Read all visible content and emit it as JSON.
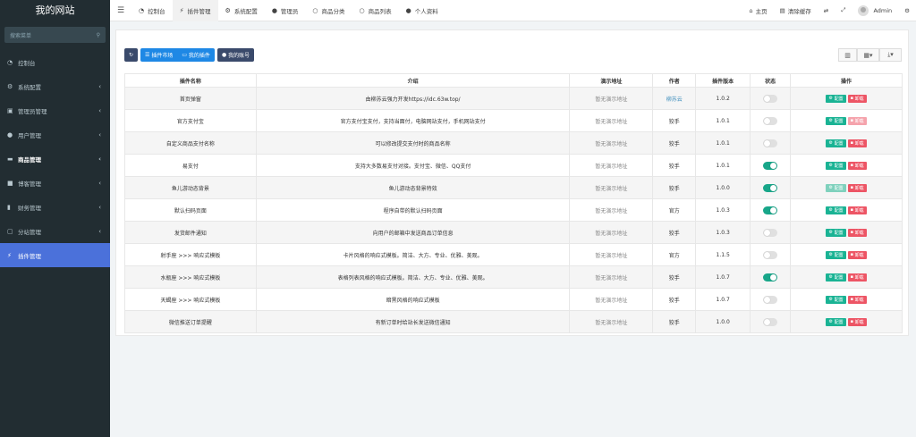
{
  "brand": "我的网站",
  "search": {
    "placeholder": "搜索菜单"
  },
  "menu": [
    {
      "label": "控制台",
      "icon": "dashboard-icon",
      "glyph": "◔",
      "chevron": false,
      "bold": false,
      "active": false
    },
    {
      "label": "系统配置",
      "icon": "gears-icon",
      "glyph": "⚙",
      "chevron": true,
      "bold": false,
      "active": false
    },
    {
      "label": "管理员管理",
      "icon": "users-icon",
      "glyph": "▣",
      "chevron": true,
      "bold": false,
      "active": false
    },
    {
      "label": "用户管理",
      "icon": "user-icon",
      "glyph": "●",
      "chevron": true,
      "bold": false,
      "active": false
    },
    {
      "label": "商品管理",
      "icon": "cart-icon",
      "glyph": "▬",
      "chevron": true,
      "bold": true,
      "active": false
    },
    {
      "label": "博客管理",
      "icon": "book-icon",
      "glyph": "■",
      "chevron": true,
      "bold": false,
      "active": false
    },
    {
      "label": "财务管理",
      "icon": "bookmark-icon",
      "glyph": "▮",
      "chevron": true,
      "bold": false,
      "active": false
    },
    {
      "label": "分站管理",
      "icon": "clone-icon",
      "glyph": "▢",
      "chevron": true,
      "bold": false,
      "active": false
    },
    {
      "label": "插件管理",
      "icon": "plug-icon",
      "glyph": "⚡",
      "chevron": false,
      "bold": false,
      "active": true
    }
  ],
  "tabs": [
    {
      "label": "控制台",
      "icon": "dashboard-icon",
      "glyph": "◔",
      "active": false
    },
    {
      "label": "插件管理",
      "icon": "plug-icon",
      "glyph": "⚡",
      "active": true
    },
    {
      "label": "系统配置",
      "icon": "gear-icon",
      "glyph": "⚙",
      "active": false
    },
    {
      "label": "管理员",
      "icon": "user-icon",
      "glyph": "●",
      "active": false
    },
    {
      "label": "商品分类",
      "icon": "circle-icon",
      "glyph": "○",
      "active": false
    },
    {
      "label": "商品列表",
      "icon": "circle-icon",
      "glyph": "○",
      "active": false
    },
    {
      "label": "个人资料",
      "icon": "user-icon",
      "glyph": "●",
      "active": false
    }
  ],
  "topright": {
    "home": "主页",
    "clear_cache": "清除缓存",
    "user": "Admin"
  },
  "toolbar": {
    "market": "插件市场",
    "mine": "我的插件",
    "account": "我的账号"
  },
  "table": {
    "headers": [
      "插件名称",
      "介绍",
      "演示地址",
      "作者",
      "插件版本",
      "状态",
      "操作"
    ],
    "config_label": "配置",
    "uninstall_label": "卸载",
    "rows": [
      {
        "name": "首页弹窗",
        "desc": "由柳苏云强力开发https://idc.63w.top/",
        "demo": "暂无演示地址",
        "author": "柳苏云",
        "author_link": true,
        "version": "1.0.2",
        "on": false,
        "config_light": false,
        "uninstall_light": false
      },
      {
        "name": "官方支付宝",
        "desc": "官方支付宝支付，支持当面付，电脑网站支付，手机网站支付",
        "demo": "暂无演示地址",
        "author": "狡手",
        "author_link": false,
        "version": "1.0.1",
        "on": false,
        "config_light": false,
        "uninstall_light": true
      },
      {
        "name": "自定义商品支付名称",
        "desc": "可以修改提交支付时的商品名称",
        "demo": "暂无演示地址",
        "author": "狡手",
        "author_link": false,
        "version": "1.0.1",
        "on": false,
        "config_light": false,
        "uninstall_light": false
      },
      {
        "name": "易支付",
        "desc": "支持大多数易支付对接。支付宝、微信、QQ支付",
        "demo": "暂无演示地址",
        "author": "狡手",
        "author_link": false,
        "version": "1.0.1",
        "on": true,
        "config_light": false,
        "uninstall_light": false
      },
      {
        "name": "鱼儿游动态背景",
        "desc": "鱼儿游动态背景特效",
        "demo": "暂无演示地址",
        "author": "狡手",
        "author_link": false,
        "version": "1.0.0",
        "on": true,
        "config_light": true,
        "uninstall_light": false
      },
      {
        "name": "默认扫码页面",
        "desc": "程序自带的默认扫码页面",
        "demo": "暂无演示地址",
        "author": "官方",
        "author_link": false,
        "version": "1.0.3",
        "on": true,
        "config_light": false,
        "uninstall_light": false
      },
      {
        "name": "发货邮件通知",
        "desc": "向用户的邮箱中发送商品订单信息",
        "demo": "暂无演示地址",
        "author": "狡手",
        "author_link": false,
        "version": "1.0.3",
        "on": false,
        "config_light": false,
        "uninstall_light": false
      },
      {
        "name": "射手座 >>> 响应式模板",
        "desc": "卡片风格的响应式模板。简洁、大方、专业、优雅、美观。",
        "demo": "暂无演示地址",
        "author": "官方",
        "author_link": false,
        "version": "1.1.5",
        "on": false,
        "config_light": false,
        "uninstall_light": false
      },
      {
        "name": "水瓶座 >>> 响应式模板",
        "desc": "表格列表风格的响应式模板。简洁、大方、专业、优雅、美观。",
        "demo": "暂无演示地址",
        "author": "狡手",
        "author_link": false,
        "version": "1.0.7",
        "on": true,
        "config_light": false,
        "uninstall_light": false
      },
      {
        "name": "天蝎座 >>> 响应式模板",
        "desc": "暗黑风格的响应式模板",
        "demo": "暂无演示地址",
        "author": "狡手",
        "author_link": false,
        "version": "1.0.7",
        "on": false,
        "config_light": false,
        "uninstall_light": false
      },
      {
        "name": "微信推送订单提醒",
        "desc": "有新订单时给站长发送微信通知",
        "demo": "暂无演示地址",
        "author": "狡手",
        "author_link": false,
        "version": "1.0.0",
        "on": false,
        "config_light": false,
        "uninstall_light": false
      }
    ]
  },
  "colors": {
    "sidebar_bg": "#222d32",
    "active_menu": "#4b71da",
    "toggle_on": "#18a689",
    "config_btn": "#1ab394",
    "uninstall_btn": "#ed5565",
    "link": "#3c8dbc"
  }
}
